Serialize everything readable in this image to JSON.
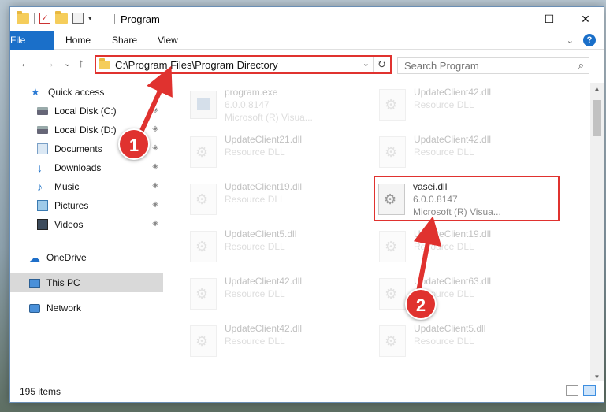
{
  "window": {
    "title": "Program",
    "controls": {
      "minimize": "—",
      "maximize": "☐",
      "close": "✕"
    }
  },
  "ribbon": {
    "tabs": [
      "File",
      "Home",
      "Share",
      "View"
    ],
    "expand_icon": "chevron-down-icon",
    "help_icon": "?"
  },
  "nav": {
    "back": "←",
    "forward": "→",
    "recent": "⌄",
    "up": "↑"
  },
  "address": {
    "path": "C:\\Program Files\\Program Directory",
    "dropdown": "⌄",
    "refresh": "↻"
  },
  "search": {
    "placeholder": "Search Program",
    "icon": "⌕"
  },
  "sidebar": {
    "items": [
      {
        "label": "Quick access",
        "icon": "star-icon",
        "pinned": false
      },
      {
        "label": "Local Disk (C:)",
        "icon": "disk-icon",
        "pinned": true
      },
      {
        "label": "Local Disk (D:)",
        "icon": "disk-icon",
        "pinned": true
      },
      {
        "label": "Documents",
        "icon": "documents-icon",
        "pinned": true
      },
      {
        "label": "Downloads",
        "icon": "downloads-icon",
        "pinned": true
      },
      {
        "label": "Music",
        "icon": "music-icon",
        "pinned": true
      },
      {
        "label": "Pictures",
        "icon": "pictures-icon",
        "pinned": true
      },
      {
        "label": "Videos",
        "icon": "videos-icon",
        "pinned": true
      },
      {
        "label": "OneDrive",
        "icon": "onedrive-icon",
        "pinned": false
      },
      {
        "label": "This PC",
        "icon": "this-pc-icon",
        "pinned": false,
        "selected": true
      },
      {
        "label": "Network",
        "icon": "network-icon",
        "pinned": false
      }
    ],
    "pin_glyph": "📌"
  },
  "files": [
    {
      "name": "program.exe",
      "line2": "6.0.0.8147",
      "line3": "Microsoft (R) Visua...",
      "type": "exe",
      "faded": true
    },
    {
      "name": "UpdateClient42.dll",
      "line2": "Resource DLL",
      "line3": "",
      "type": "dll",
      "faded": true
    },
    {
      "name": "UpdateClient21.dll",
      "line2": "Resource DLL",
      "line3": "",
      "type": "dll",
      "faded": true
    },
    {
      "name": "UpdateClient42.dll",
      "line2": "Resource DLL",
      "line3": "",
      "type": "dll",
      "faded": true
    },
    {
      "name": "UpdateClient19.dll",
      "line2": "Resource DLL",
      "line3": "",
      "type": "dll",
      "faded": true
    },
    {
      "name": "vasei.dll",
      "line2": "6.0.0.8147",
      "line3": "Microsoft (R) Visua...",
      "type": "dll",
      "faded": false,
      "highlighted": true
    },
    {
      "name": "UpdateClient5.dll",
      "line2": "Resource DLL",
      "line3": "",
      "type": "dll",
      "faded": true
    },
    {
      "name": "UpdateClient19.dll",
      "line2": "Resource DLL",
      "line3": "",
      "type": "dll",
      "faded": true
    },
    {
      "name": "UpdateClient42.dll",
      "line2": "Resource DLL",
      "line3": "",
      "type": "dll",
      "faded": true
    },
    {
      "name": "UpdateClient63.dll",
      "line2": "Resource DLL",
      "line3": "",
      "type": "dll",
      "faded": true
    },
    {
      "name": "UpdateClient42.dll",
      "line2": "Resource DLL",
      "line3": "",
      "type": "dll",
      "faded": true
    },
    {
      "name": "UpdateClient5.dll",
      "line2": "Resource DLL",
      "line3": "",
      "type": "dll",
      "faded": true
    }
  ],
  "status": {
    "count": "195 items"
  },
  "annotations": [
    {
      "label": "1",
      "color": "#e0322f"
    },
    {
      "label": "2",
      "color": "#e0322f"
    }
  ],
  "colors": {
    "accent": "#1a6fc9",
    "highlight": "#e0322f"
  }
}
